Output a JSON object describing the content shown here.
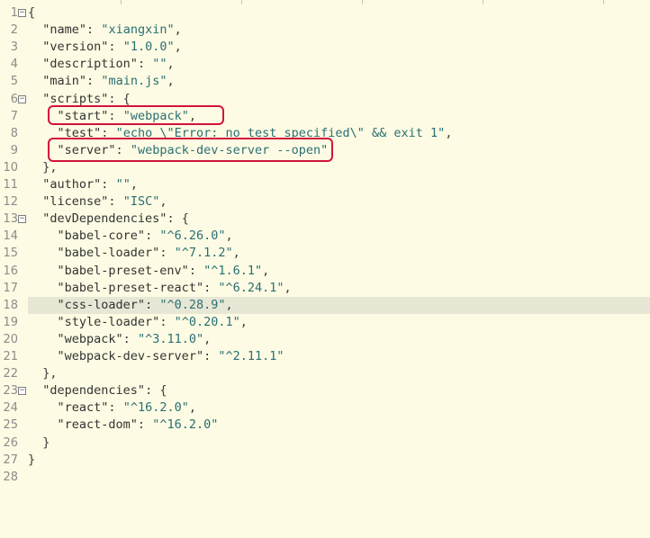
{
  "editor": {
    "fold_glyph": "−",
    "lines": [
      {
        "n": "1",
        "fold": true,
        "text": "{"
      },
      {
        "n": "2",
        "fold": false,
        "text": "  \"name\": \"xiangxin\","
      },
      {
        "n": "3",
        "fold": false,
        "text": "  \"version\": \"1.0.0\","
      },
      {
        "n": "4",
        "fold": false,
        "text": "  \"description\": \"\","
      },
      {
        "n": "5",
        "fold": false,
        "text": "  \"main\": \"main.js\","
      },
      {
        "n": "6",
        "fold": true,
        "text": "  \"scripts\": {"
      },
      {
        "n": "7",
        "fold": false,
        "text": "    \"start\": \"webpack\","
      },
      {
        "n": "8",
        "fold": false,
        "text": "    \"test\": \"echo \\\"Error: no test specified\\\" && exit 1\","
      },
      {
        "n": "9",
        "fold": false,
        "text": "    \"server\": \"webpack-dev-server --open\""
      },
      {
        "n": "10",
        "fold": false,
        "text": "  },"
      },
      {
        "n": "11",
        "fold": false,
        "text": "  \"author\": \"\","
      },
      {
        "n": "12",
        "fold": false,
        "text": "  \"license\": \"ISC\","
      },
      {
        "n": "13",
        "fold": true,
        "text": "  \"devDependencies\": {"
      },
      {
        "n": "14",
        "fold": false,
        "text": "    \"babel-core\": \"^6.26.0\","
      },
      {
        "n": "15",
        "fold": false,
        "text": "    \"babel-loader\": \"^7.1.2\","
      },
      {
        "n": "16",
        "fold": false,
        "text": "    \"babel-preset-env\": \"^1.6.1\","
      },
      {
        "n": "17",
        "fold": false,
        "text": "    \"babel-preset-react\": \"^6.24.1\","
      },
      {
        "n": "18",
        "fold": false,
        "current": true,
        "text": "    \"css-loader\": \"^0.28.9\","
      },
      {
        "n": "19",
        "fold": false,
        "text": "    \"style-loader\": \"^0.20.1\","
      },
      {
        "n": "20",
        "fold": false,
        "text": "    \"webpack\": \"^3.11.0\","
      },
      {
        "n": "21",
        "fold": false,
        "text": "    \"webpack-dev-server\": \"^2.11.1\""
      },
      {
        "n": "22",
        "fold": false,
        "text": "  },"
      },
      {
        "n": "23",
        "fold": true,
        "text": "  \"dependencies\": {"
      },
      {
        "n": "24",
        "fold": false,
        "text": "    \"react\": \"^16.2.0\","
      },
      {
        "n": "25",
        "fold": false,
        "text": "    \"react-dom\": \"^16.2.0\""
      },
      {
        "n": "26",
        "fold": false,
        "text": "  }"
      },
      {
        "n": "27",
        "fold": false,
        "text": "}"
      },
      {
        "n": "28",
        "fold": false,
        "text": ""
      }
    ]
  },
  "colors": {
    "background": "#fdfbe3",
    "current_line": "#e7e7d5",
    "highlight_box": "#d2143a",
    "string": "#2a6f73"
  }
}
